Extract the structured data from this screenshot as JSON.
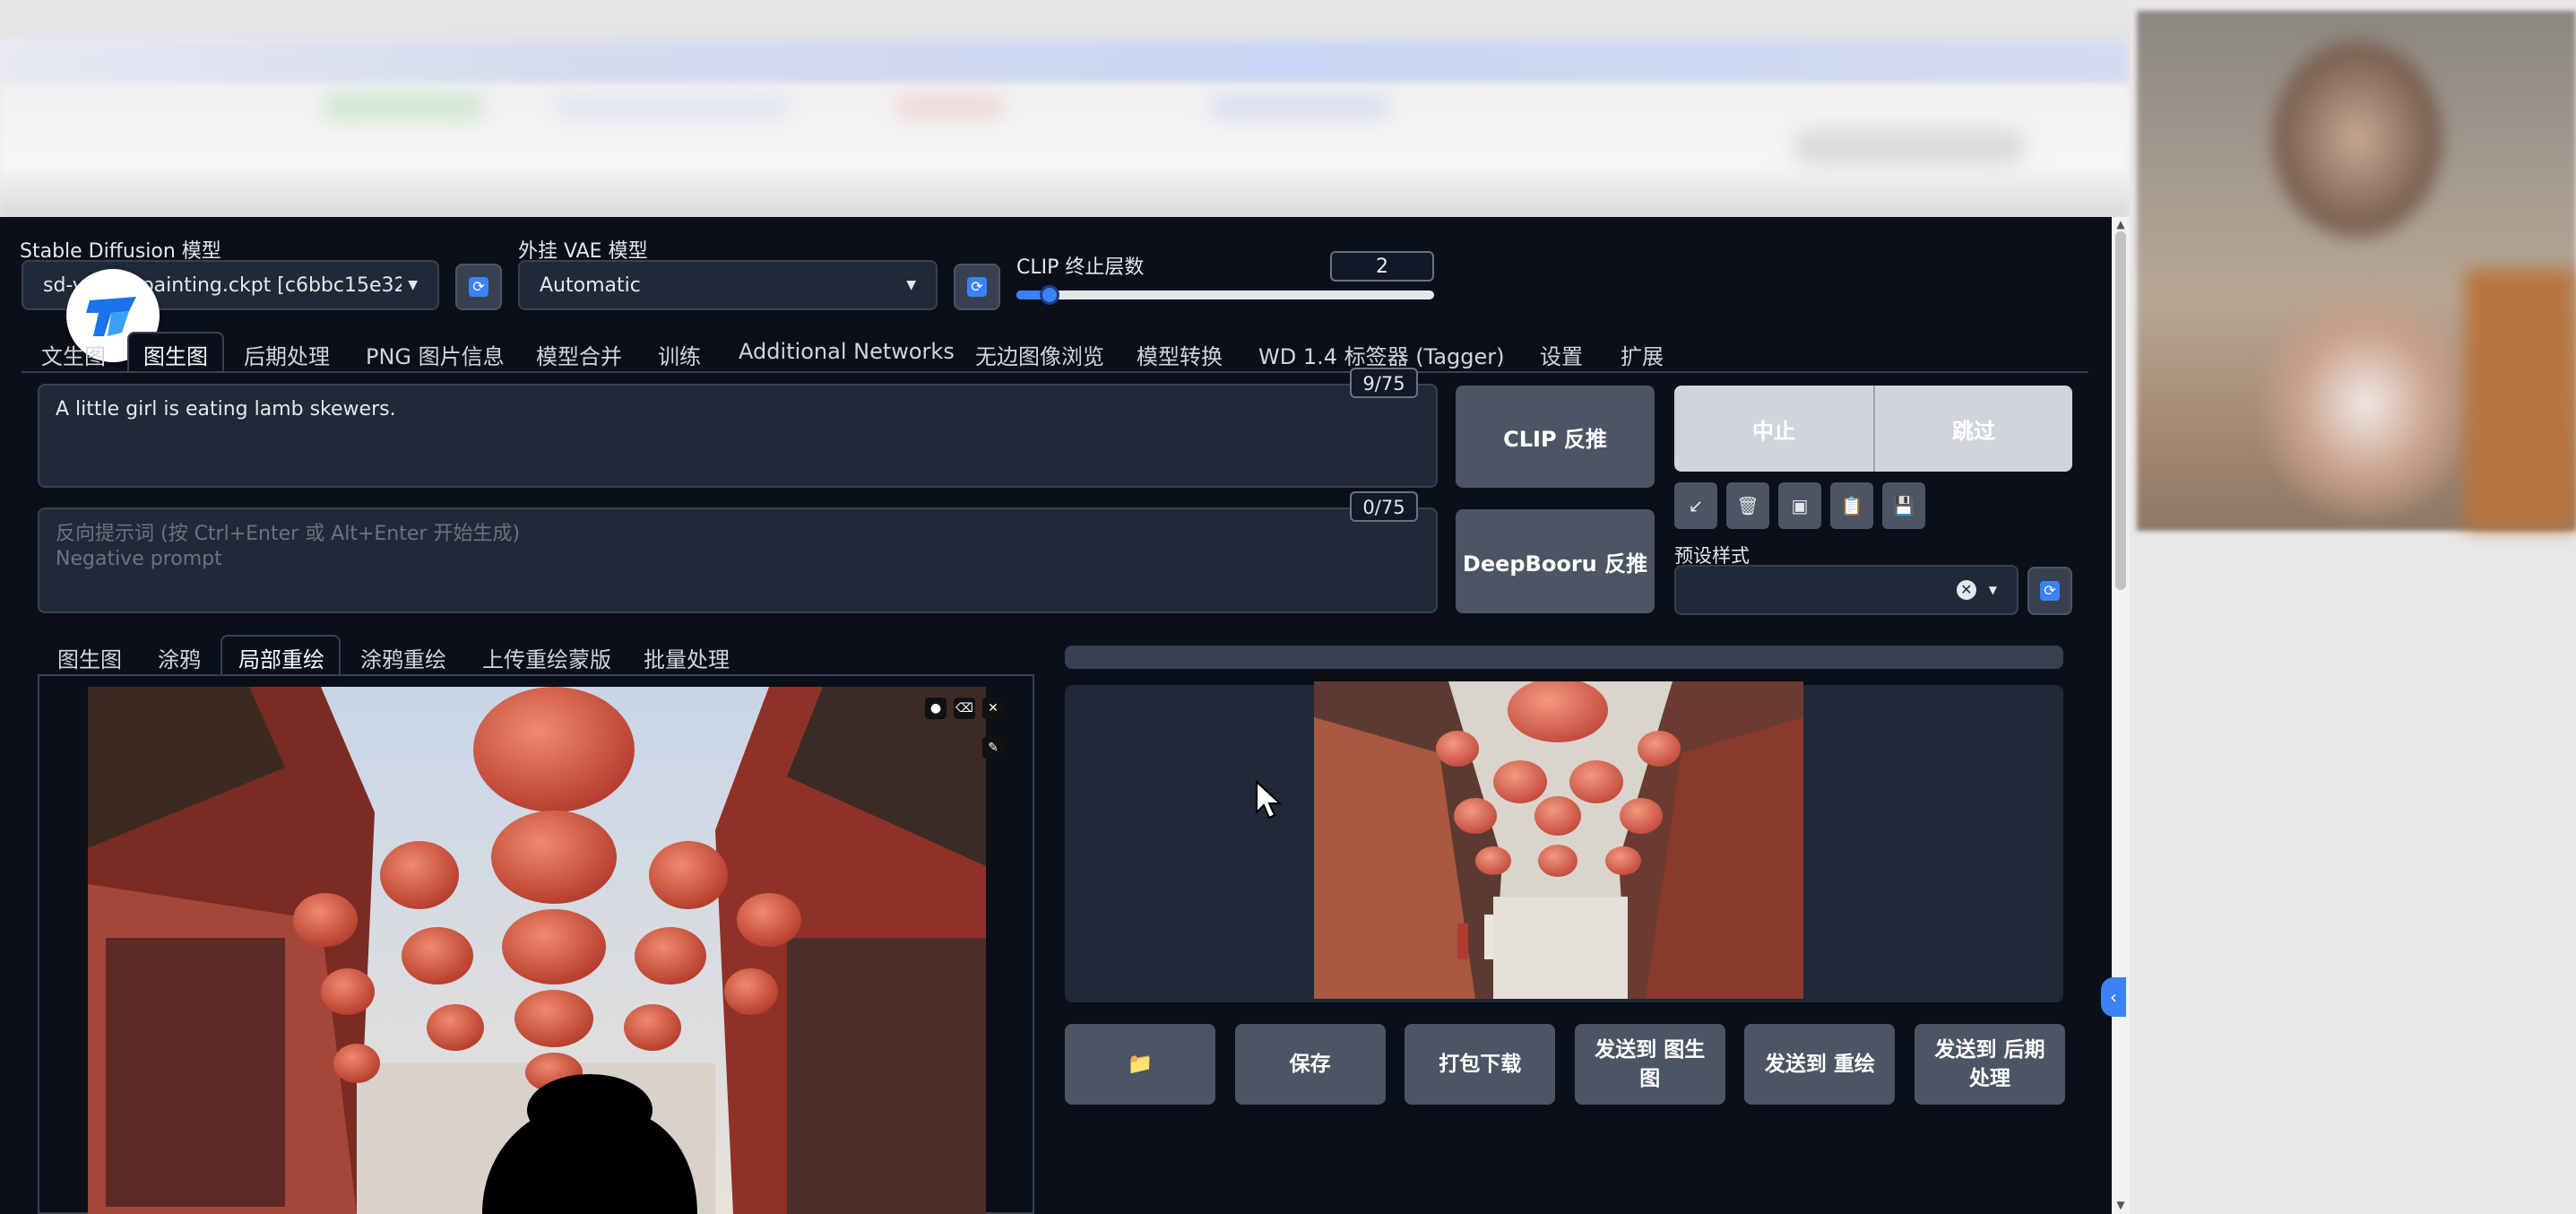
{
  "top": {
    "sd_model_label": "Stable Diffusion 模型",
    "sd_model_value": "sd-v1-5-inpainting.ckpt [c6bbc15e32]",
    "vae_label": "外挂 VAE 模型",
    "vae_value": "Automatic",
    "clip_label": "CLIP 终止层数",
    "clip_value": "2",
    "clip_fraction": 0.08
  },
  "main_tabs": [
    "文生图",
    "图生图",
    "后期处理",
    "PNG 图片信息",
    "模型合并",
    "训练",
    "Additional Networks",
    "无边图像浏览",
    "模型转换",
    "WD 1.4 标签器 (Tagger)",
    "设置",
    "扩展"
  ],
  "active_main_tab": "图生图",
  "prompt": {
    "text": "A little girl is eating lamb skewers.",
    "counter": "9/75",
    "negative_placeholder": "反向提示词 (按 Ctrl+Enter 或 Alt+Enter 开始生成)\nNegative prompt",
    "negative_counter": "0/75"
  },
  "buttons": {
    "clip_interrogate": "CLIP 反推",
    "deepbooru_interrogate": "DeepBooru 反推",
    "interrupt": "中止",
    "skip": "跳过",
    "preset_label": "预设样式"
  },
  "tools": [
    {
      "icon": "arrow-icon",
      "glyph": "↙"
    },
    {
      "icon": "trash-icon",
      "glyph": "🗑"
    },
    {
      "icon": "card-icon",
      "glyph": "▣"
    },
    {
      "icon": "clipboard-icon",
      "glyph": "📋"
    },
    {
      "icon": "save-icon",
      "glyph": "💾"
    }
  ],
  "sub_tabs": [
    "图生图",
    "涂鸦",
    "局部重绘",
    "涂鸦重绘",
    "上传重绘蒙版",
    "批量处理"
  ],
  "active_sub_tab": "局部重绘",
  "output_actions": [
    "📁",
    "保存",
    "打包下载",
    "发送到 图生图",
    "发送到 重绘",
    "发送到 后期处理"
  ],
  "colors": {
    "app_bg": "#0b0f19",
    "panel": "#1f2937",
    "button": "#4b5563",
    "accent": "#3b82f6"
  }
}
